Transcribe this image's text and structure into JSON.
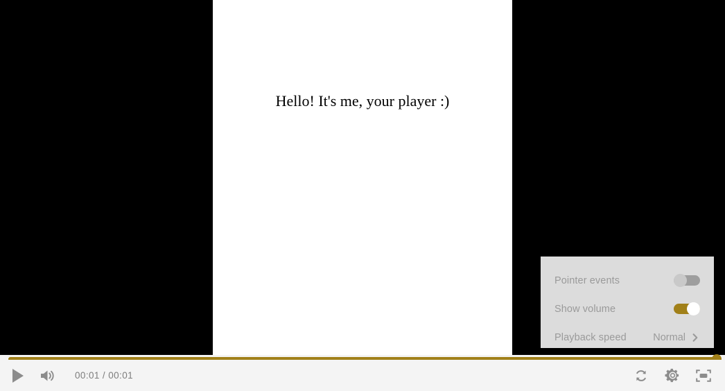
{
  "player": {
    "video_text": "Hello! It's me, your player :)",
    "background_color": "#000000",
    "frame_color": "#ffffff",
    "accent_color": "#a18019",
    "controlbar_color": "#f4f4f4"
  },
  "controls": {
    "play_label": "play-icon",
    "volume_label": "volume-icon",
    "time_current": "00:01",
    "time_separator": "/",
    "time_duration": "00:01",
    "time_display": "00:01 / 00:01",
    "loop_label": "loop-icon",
    "settings_label": "gear-icon",
    "pip_label": "picture-in-picture-icon"
  },
  "progress": {
    "percent": 100,
    "fill_color": "#a18019",
    "thumb_color": "#a18019"
  },
  "settings_menu": {
    "background_color": "#dcdcdc",
    "text_color": "#9a9a9a",
    "rows": [
      {
        "label": "Pointer events",
        "type": "toggle",
        "state": "off"
      },
      {
        "label": "Show volume",
        "type": "toggle",
        "state": "on"
      },
      {
        "label": "Playback speed",
        "type": "submenu",
        "value": "Normal"
      }
    ]
  }
}
